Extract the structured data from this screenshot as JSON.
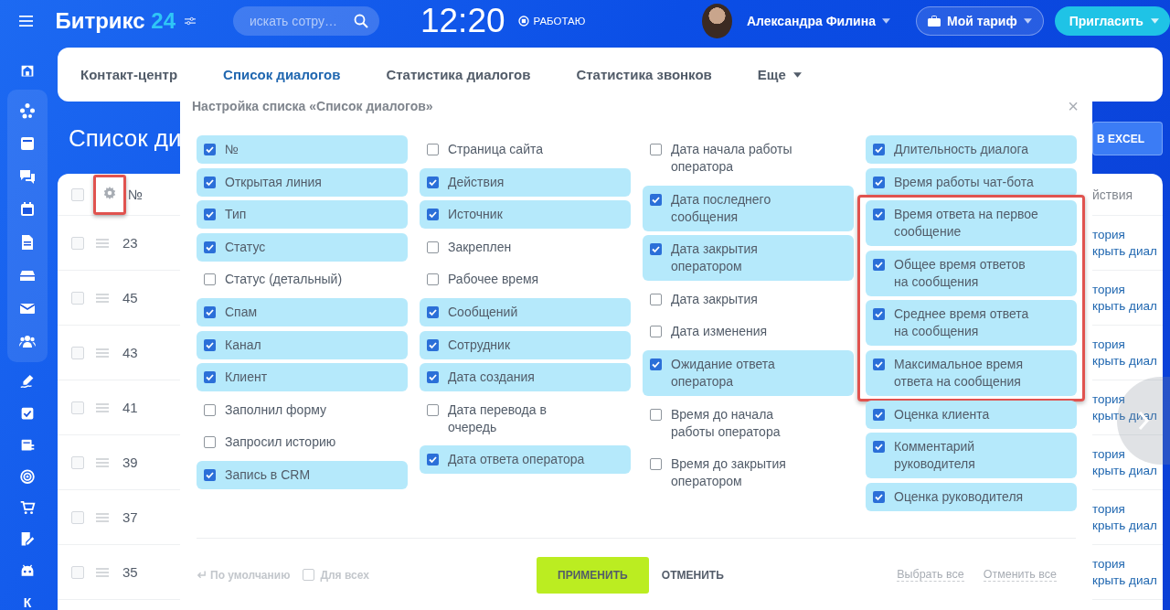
{
  "topbar": {
    "logo_text": "Битрикс",
    "logo_number": "24",
    "search": {
      "placeholder": "искать сотру…"
    },
    "clock": "12:20",
    "work_status": "РАБОТАЮ",
    "user_name": "Александра Филина",
    "plan_button": "Мой тариф",
    "invite_button": "Пригласить"
  },
  "sidebar": {
    "footer_label": "К"
  },
  "tabs": [
    {
      "label": "Контакт-центр",
      "selected": false,
      "dropdown": false
    },
    {
      "label": "Список диалогов",
      "selected": true,
      "dropdown": false
    },
    {
      "label": "Статистика диалогов",
      "selected": false,
      "dropdown": false
    },
    {
      "label": "Статистика звонков",
      "selected": false,
      "dropdown": false
    },
    {
      "label": "Еще",
      "selected": false,
      "dropdown": true
    }
  ],
  "page_title": "Список ди",
  "export_button": "В EXCEL",
  "table": {
    "header": {
      "number": "№",
      "actions": "йствия",
      "settings_highlighted": true,
      "checked": false
    },
    "rows": [
      {
        "number": "23",
        "checked": false,
        "links": [
          "тория",
          "крыть диал"
        ]
      },
      {
        "number": "45",
        "checked": false,
        "links": [
          "тория",
          "крыть диал"
        ]
      },
      {
        "number": "43",
        "checked": false,
        "links": [
          "тория",
          "крыть диал"
        ]
      },
      {
        "number": "41",
        "checked": false,
        "links": [
          "тория",
          "крыть диал"
        ]
      },
      {
        "number": "39",
        "checked": false,
        "links": [
          "тория",
          "крыть диал"
        ]
      },
      {
        "number": "37",
        "checked": false,
        "links": [
          "тория",
          "крыть диал"
        ]
      },
      {
        "number": "35",
        "checked": false,
        "links": [
          "тория",
          "крыть диал"
        ]
      }
    ]
  },
  "dialog": {
    "title": "Настройка списка «Список диалогов»",
    "close": "×",
    "columns": [
      {
        "items": [
          {
            "label": "№",
            "checked": true
          },
          {
            "label": "Открытая линия",
            "checked": true
          },
          {
            "label": "Тип",
            "checked": true
          },
          {
            "label": "Статус",
            "checked": true
          },
          {
            "label": "Статус (детальный)",
            "checked": false
          },
          {
            "label": "Спам",
            "checked": true
          },
          {
            "label": "Канал",
            "checked": true
          },
          {
            "label": "Клиент",
            "checked": true
          },
          {
            "label": "Заполнил форму",
            "checked": false
          },
          {
            "label": "Запросил историю",
            "checked": false
          },
          {
            "label": "Запись в CRM",
            "checked": true
          }
        ]
      },
      {
        "items": [
          {
            "label": "Страница сайта",
            "checked": false
          },
          {
            "label": "Действия",
            "checked": true
          },
          {
            "label": "Источник",
            "checked": true
          },
          {
            "label": "Закреплен",
            "checked": false
          },
          {
            "label": "Рабочее время",
            "checked": false
          },
          {
            "label": "Сообщений",
            "checked": true
          },
          {
            "label": "Сотрудник",
            "checked": true
          },
          {
            "label": "Дата создания",
            "checked": true
          },
          {
            "label": "Дата перевода в очередь",
            "checked": false
          },
          {
            "label": "Дата ответа оператора",
            "checked": true
          }
        ]
      },
      {
        "items": [
          {
            "label": "Дата начала работы оператора",
            "checked": false
          },
          {
            "label": "Дата последнего сообщения",
            "checked": true
          },
          {
            "label": "Дата закрытия оператором",
            "checked": true
          },
          {
            "label": "Дата закрытия",
            "checked": false
          },
          {
            "label": "Дата изменения",
            "checked": false
          },
          {
            "label": "Ожидание ответа оператора",
            "checked": true
          },
          {
            "label": "Время до начала работы оператора",
            "checked": false
          },
          {
            "label": "Время до закрытия оператором",
            "checked": false
          }
        ]
      },
      {
        "items": [
          {
            "label": "Длительность диалога",
            "checked": true,
            "highlighted": false
          },
          {
            "label": "Время работы чат-бота",
            "checked": true,
            "highlighted": false
          },
          {
            "label": "Время ответа на первое сообщение",
            "checked": true,
            "highlighted": true
          },
          {
            "label": "Общее время ответов на сообщения",
            "checked": true,
            "highlighted": true
          },
          {
            "label": "Среднее время ответа на сообщения",
            "checked": true,
            "highlighted": true
          },
          {
            "label": "Максимальное время ответа на сообщения",
            "checked": true,
            "highlighted": true
          },
          {
            "label": "Оценка клиента",
            "checked": true,
            "highlighted": false
          },
          {
            "label": "Комментарий руководителя",
            "checked": true,
            "highlighted": false
          },
          {
            "label": "Оценка руководителя",
            "checked": true,
            "highlighted": false
          }
        ]
      }
    ],
    "footer": {
      "reset": {
        "label": "По умолчанию",
        "disabled": true
      },
      "for_all": {
        "label": "Для всех",
        "checked": false,
        "disabled": true
      },
      "apply": "ПРИМЕНИТЬ",
      "cancel": "ОТМЕНИТЬ",
      "select_all": "Выбрать все",
      "deselect_all": "Отменить все"
    }
  }
}
